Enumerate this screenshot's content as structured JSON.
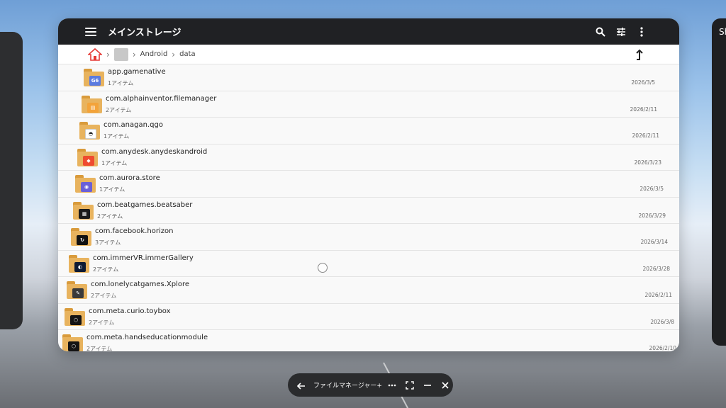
{
  "appbar": {
    "title": "メインストレージ",
    "icons": [
      "menu-icon",
      "search-icon",
      "sliders-icon",
      "more-vertical-icon"
    ]
  },
  "breadcrumb": {
    "items": [
      "Android",
      "data"
    ]
  },
  "files": [
    {
      "name": "app.gamenative",
      "count": "1アイテム",
      "date": "2026/3/5",
      "badge": "G6",
      "badge_color": "#5b7be0"
    },
    {
      "name": "com.alphainventor.filemanager",
      "count": "2アイテム",
      "date": "2026/2/11",
      "badge": "▤",
      "badge_color": "#f3a33a"
    },
    {
      "name": "com.anagan.qgo",
      "count": "1アイテム",
      "date": "2026/2/11",
      "badge": "◓",
      "badge_color": "#ffffff"
    },
    {
      "name": "com.anydesk.anydeskandroid",
      "count": "1アイテム",
      "date": "2026/3/23",
      "badge": "◆",
      "badge_color": "#ef4b2f"
    },
    {
      "name": "com.aurora.store",
      "count": "1アイテム",
      "date": "2026/3/5",
      "badge": "◉",
      "badge_color": "#6a5fd8"
    },
    {
      "name": "com.beatgames.beatsaber",
      "count": "2アイテム",
      "date": "2026/3/29",
      "badge": "▦",
      "badge_color": "#1a1a1a"
    },
    {
      "name": "com.facebook.horizon",
      "count": "3アイテム",
      "date": "2026/3/14",
      "badge": "↻",
      "badge_color": "#111111"
    },
    {
      "name": "com.immerVR.immerGallery",
      "count": "2アイテム",
      "date": "2026/3/28",
      "badge": "◐",
      "badge_color": "#0d1a33"
    },
    {
      "name": "com.lonelycatgames.Xplore",
      "count": "2アイテム",
      "date": "2026/2/11",
      "badge": "✎",
      "badge_color": "#3a3a3a"
    },
    {
      "name": "com.meta.curio.toybox",
      "count": "2アイテム",
      "date": "2026/3/8",
      "badge": "⬡",
      "badge_color": "#141414"
    },
    {
      "name": "com.meta.handseducationmodule",
      "count": "2アイテム",
      "date": "2026/2/10",
      "badge": "⬡",
      "badge_color": "#141414"
    }
  ],
  "taskbar": {
    "label": "ファイルマネージャー+"
  },
  "side_panel_right": {
    "text": "Sh"
  }
}
